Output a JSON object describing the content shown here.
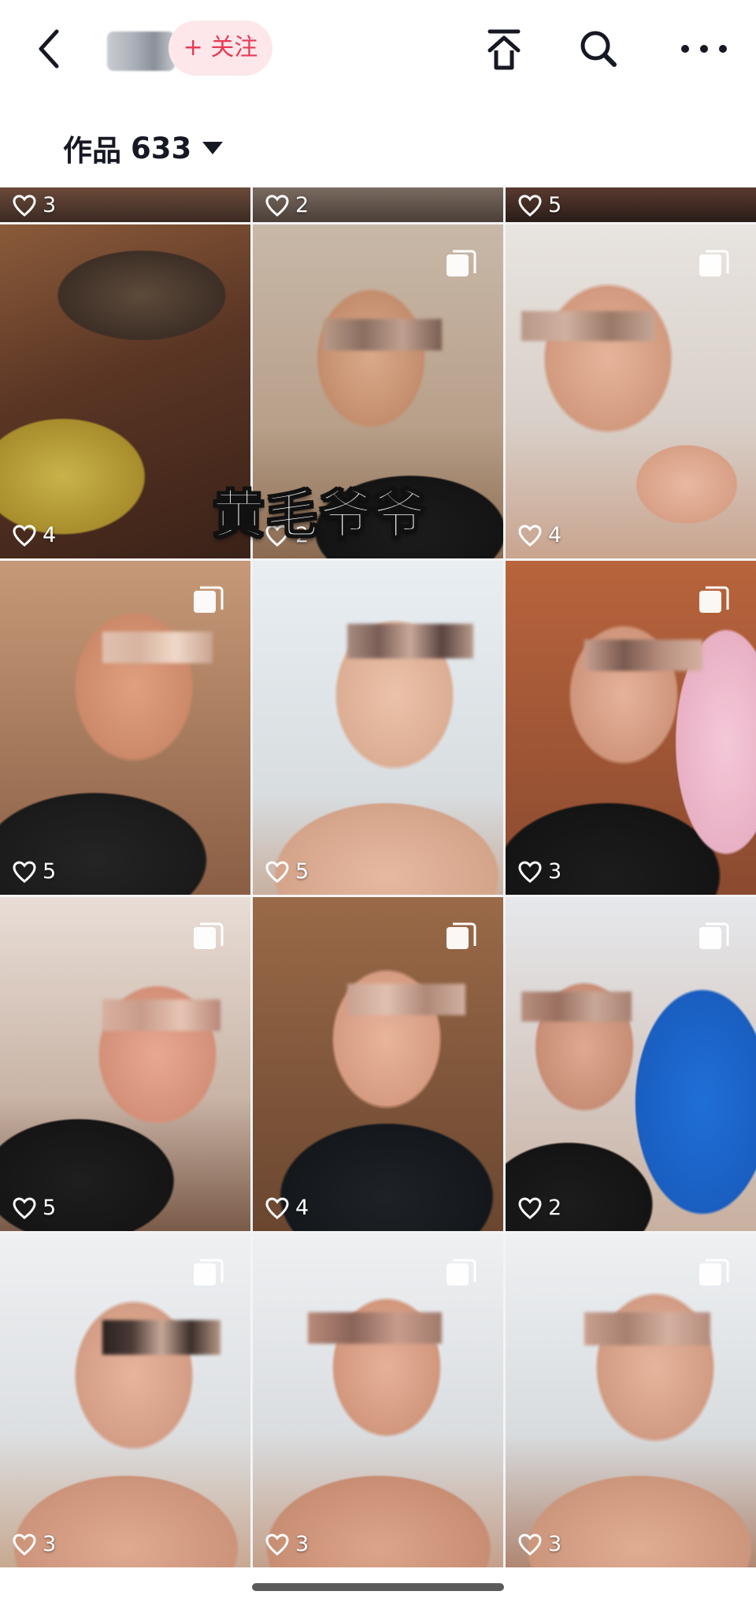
{
  "header": {
    "follow_label": "+ 关注",
    "icons": [
      "back-icon",
      "upload-icon",
      "search-icon",
      "more-icon"
    ]
  },
  "works": {
    "label": "作品",
    "count": "633"
  },
  "overlay_caption": "黄毛爷爷",
  "grid": {
    "partial_row_likes": [
      "3",
      "2",
      "5"
    ],
    "rows": [
      [
        "4",
        "2",
        "4"
      ],
      [
        "5",
        "5",
        "3"
      ],
      [
        "5",
        "4",
        "2"
      ],
      [
        "3",
        "3",
        "3"
      ]
    ]
  },
  "colors": {
    "follow_text": "#e83a55",
    "follow_bg": "#fde7ea",
    "text_primary": "#161823"
  }
}
